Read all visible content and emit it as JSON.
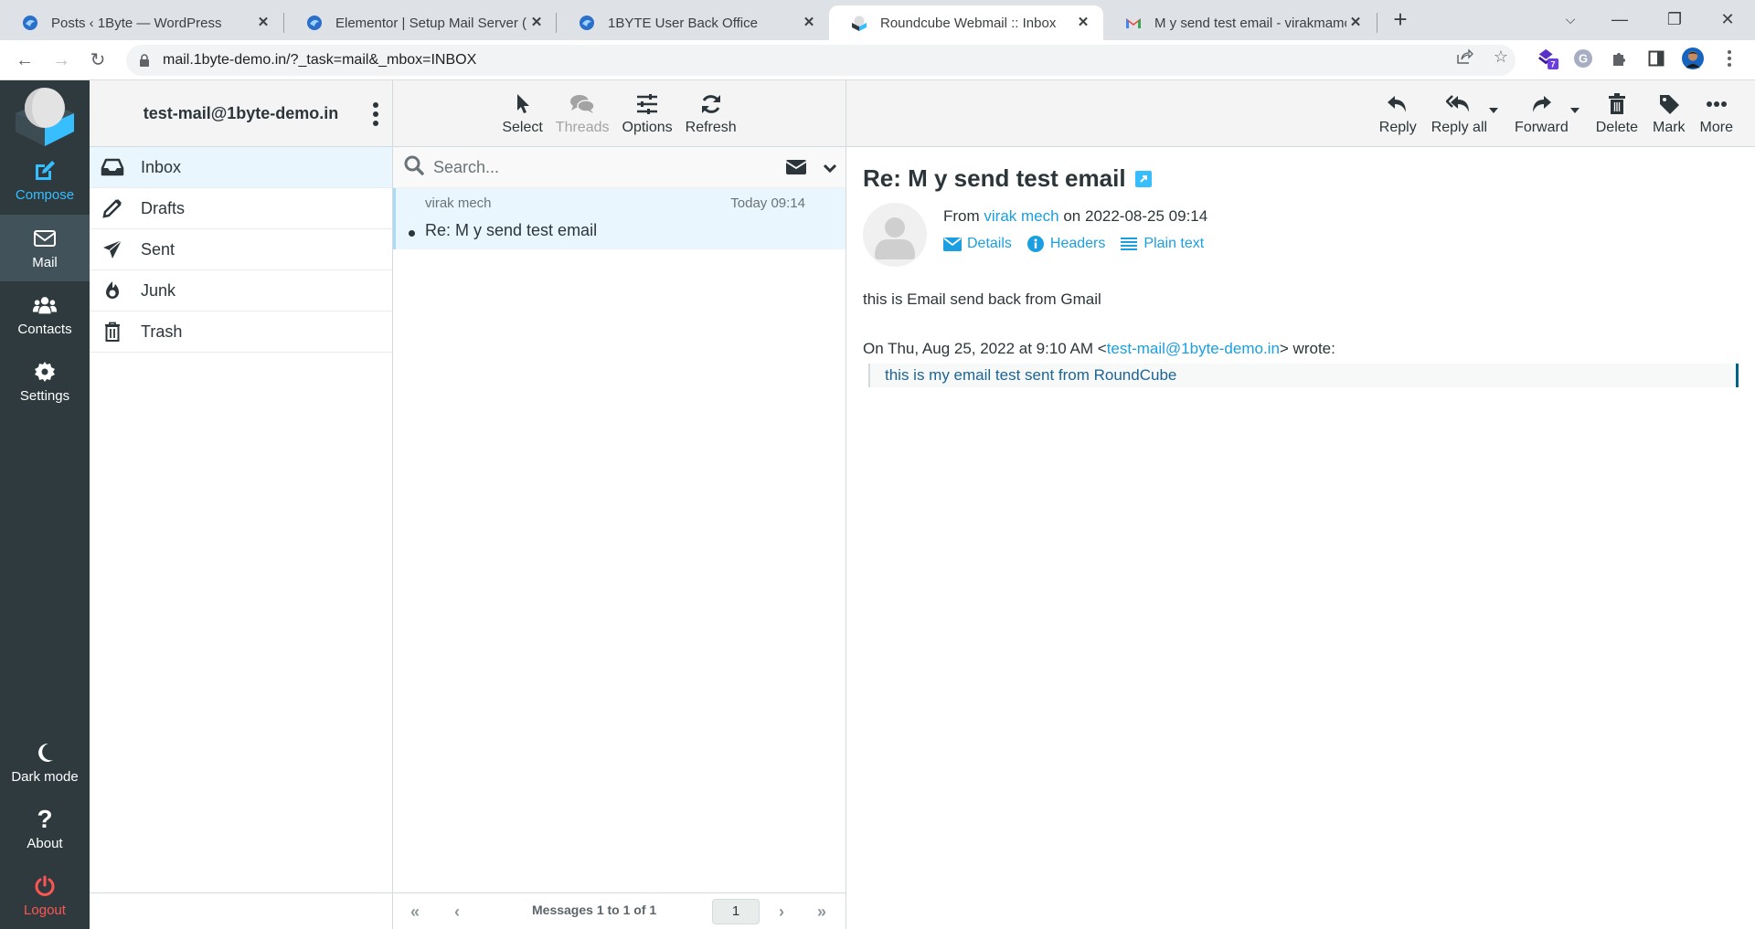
{
  "browser": {
    "tabs": [
      {
        "title": "Posts ‹ 1Byte — WordPress",
        "favicon": "1byte-icon",
        "active": false
      },
      {
        "title": "Elementor | Setup Mail Server (Ro",
        "favicon": "1byte-icon",
        "active": false
      },
      {
        "title": "1BYTE User Back Office",
        "favicon": "1byte-icon",
        "active": false
      },
      {
        "title": "Roundcube Webmail :: Inbox",
        "favicon": "roundcube-icon",
        "active": true
      },
      {
        "title": "M y send test email - virakmamo",
        "favicon": "gmail-icon",
        "active": false
      }
    ],
    "url": "mail.1byte-demo.in/?_task=mail&_mbox=INBOX",
    "extension_badge": "7"
  },
  "taskmenu": {
    "compose": "Compose",
    "mail": "Mail",
    "contacts": "Contacts",
    "settings": "Settings",
    "darkmode": "Dark mode",
    "about": "About",
    "logout": "Logout"
  },
  "folders": {
    "account": "test-mail@1byte-demo.in",
    "items": [
      {
        "label": "Inbox",
        "icon": "inbox-icon",
        "selected": true
      },
      {
        "label": "Drafts",
        "icon": "pencil-icon",
        "selected": false
      },
      {
        "label": "Sent",
        "icon": "paper-plane-icon",
        "selected": false
      },
      {
        "label": "Junk",
        "icon": "fire-icon",
        "selected": false
      },
      {
        "label": "Trash",
        "icon": "trash-icon",
        "selected": false
      }
    ]
  },
  "messagelist": {
    "toolbar": {
      "select": "Select",
      "threads": "Threads",
      "options": "Options",
      "refresh": "Refresh"
    },
    "search_placeholder": "Search...",
    "messages": [
      {
        "from": "virak mech",
        "date": "Today 09:14",
        "subject": "Re: M y send test email",
        "unread": false
      }
    ],
    "pager": {
      "count": "Messages 1 to 1 of 1",
      "page": "1"
    }
  },
  "preview": {
    "toolbar": {
      "reply": "Reply",
      "reply_all": "Reply all",
      "forward": "Forward",
      "delete": "Delete",
      "mark": "Mark",
      "more": "More"
    },
    "subject": "Re: M y send test email",
    "from_prefix": "From",
    "from_name": "virak mech",
    "date_prefix": "on",
    "date": "2022-08-25 09:14",
    "links": {
      "details": "Details",
      "headers": "Headers",
      "plaintext": "Plain text"
    },
    "body": {
      "line1": "this is Email send back from Gmail",
      "quote_intro_before": "On Thu, Aug 25, 2022 at 9:10 AM <",
      "quote_email": "test-mail@1byte-demo.in",
      "quote_intro_after": "> wrote:",
      "quoted": "this is my email test sent from RoundCube"
    }
  },
  "colors": {
    "accent": "#37beff",
    "link": "#1a9fe0",
    "logout": "#ff5552",
    "sidebar": "#2f3a3f",
    "selected_row": "#e9f6fd"
  }
}
